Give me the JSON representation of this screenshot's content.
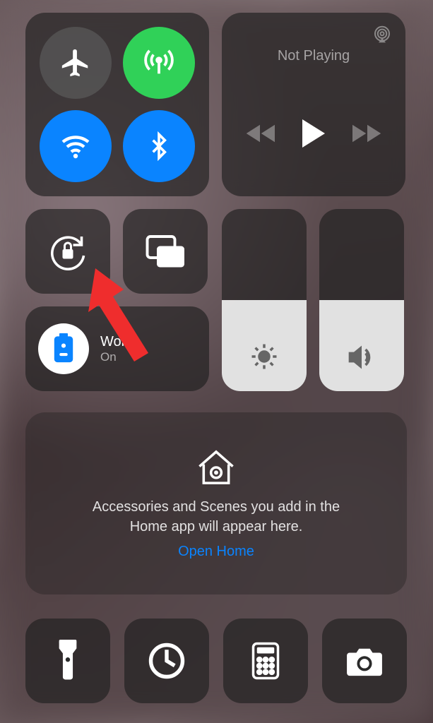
{
  "connectivity": {
    "airplane": "Airplane Mode",
    "cellular": "Cellular Data",
    "wifi": "Wi-Fi",
    "bluetooth": "Bluetooth"
  },
  "media": {
    "status": "Not Playing"
  },
  "focus": {
    "name": "Work",
    "state": "On"
  },
  "home": {
    "message_line1": "Accessories and Scenes you add in the",
    "message_line2": "Home app will appear here.",
    "link": "Open Home"
  },
  "sliders": {
    "brightness_percent": 50,
    "volume_percent": 50
  },
  "bottom": {
    "flashlight": "Flashlight",
    "timer": "Timer",
    "calculator": "Calculator",
    "camera": "Camera"
  }
}
